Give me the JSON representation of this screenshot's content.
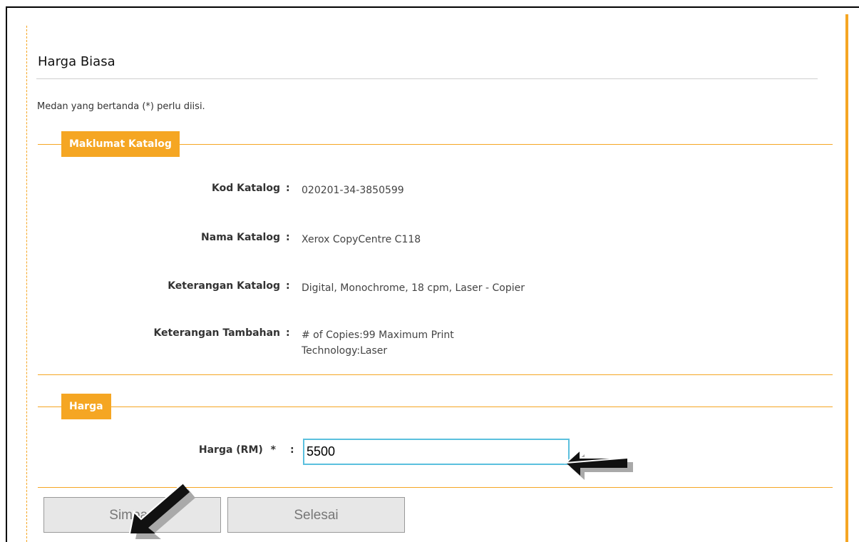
{
  "page": {
    "title": "Harga Biasa",
    "required_note": "Medan yang bertanda (*) perlu diisi."
  },
  "catalog_section": {
    "legend": "Maklumat Katalog",
    "fields": [
      {
        "label": "Kod Katalog",
        "value": "020201-34-3850599"
      },
      {
        "label": "Nama Katalog",
        "value": "Xerox CopyCentre C118"
      },
      {
        "label": "Keterangan Katalog",
        "value": "Digital, Monochrome, 18 cpm, Laser - Copier"
      },
      {
        "label": "Keterangan Tambahan",
        "value_line1": "# of Copies:99 Maximum Print",
        "value_line2": "Technology:Laser"
      }
    ]
  },
  "price_section": {
    "legend": "Harga",
    "label": "Harga (RM)",
    "required_marker": "*",
    "value": "5500"
  },
  "buttons": {
    "save_label": "Simpan",
    "finish_label": "Selesai"
  },
  "colors": {
    "accent": "#f5a623",
    "input_border": "#5bc0de"
  },
  "annotations": [
    "arrow-pointing-to-price-input",
    "arrow-pointing-to-save-button"
  ]
}
